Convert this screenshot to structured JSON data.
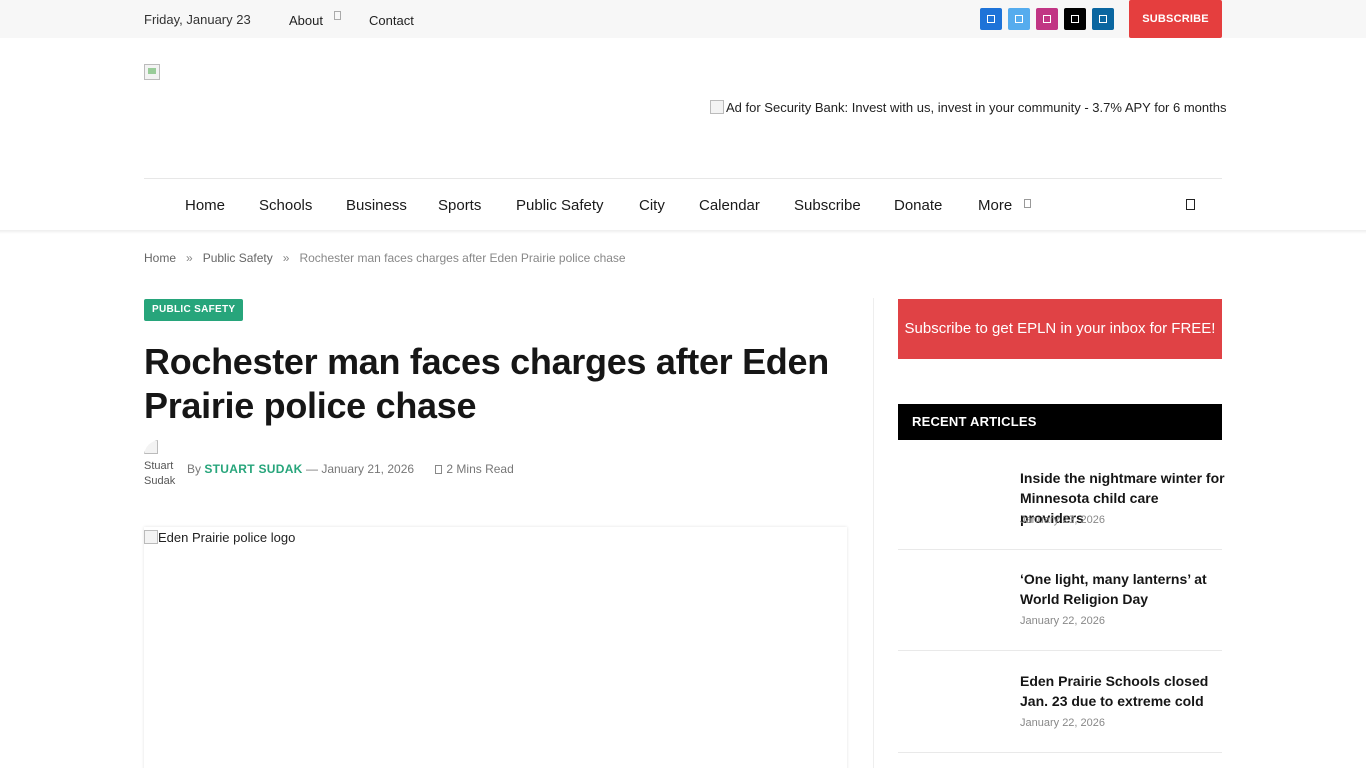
{
  "topbar": {
    "date": "Friday, January 23",
    "about": "About",
    "contact": "Contact",
    "subscribe": "SUBSCRIBE",
    "social": [
      {
        "icon": "facebook-icon",
        "color": "#1e73d8"
      },
      {
        "icon": "twitter-icon",
        "color": "#55acee"
      },
      {
        "icon": "instagram-icon",
        "color": "#c13584"
      },
      {
        "icon": "x-icon",
        "color": "#000000"
      },
      {
        "icon": "linkedin-icon",
        "color": "#0a66a0"
      }
    ]
  },
  "header": {
    "ad_alt": "Ad for Security Bank: Invest with us, invest in your community - 3.7% APY for 6 months"
  },
  "nav": {
    "items": [
      "Home",
      "Schools",
      "Business",
      "Sports",
      "Public Safety",
      "City",
      "Calendar",
      "Subscribe",
      "Donate",
      "More"
    ]
  },
  "breadcrumb": {
    "home": "Home",
    "section": "Public Safety",
    "separator": "»",
    "current": "Rochester man faces charges after Eden Prairie police chase"
  },
  "article": {
    "category": "PUBLIC SAFETY",
    "title": "Rochester man faces charges after Eden Prairie police chase",
    "author_img_alt": "Stuart Sudak",
    "by": "By",
    "author": "STUART SUDAK",
    "date_sep": "—",
    "date": "January 21, 2026",
    "read_time": "2 Mins Read",
    "image_alt": "Eden Prairie police logo"
  },
  "sidebar": {
    "promo": "Subscribe to get EPLN in your inbox for FREE!",
    "recent_heading": "RECENT ARTICLES",
    "recent": [
      {
        "title": "Inside the nightmare winter for Minnesota child care providers",
        "date": "January 23, 2026"
      },
      {
        "title": "‘One light, many lanterns’ at World Religion Day",
        "date": "January 22, 2026"
      },
      {
        "title": "Eden Prairie Schools closed Jan. 23 due to extreme cold",
        "date": "January 22, 2026"
      }
    ]
  },
  "colors": {
    "accent_green": "#27a57b",
    "subscribe_red": "#e53e3e",
    "promo_red": "#e04245"
  }
}
